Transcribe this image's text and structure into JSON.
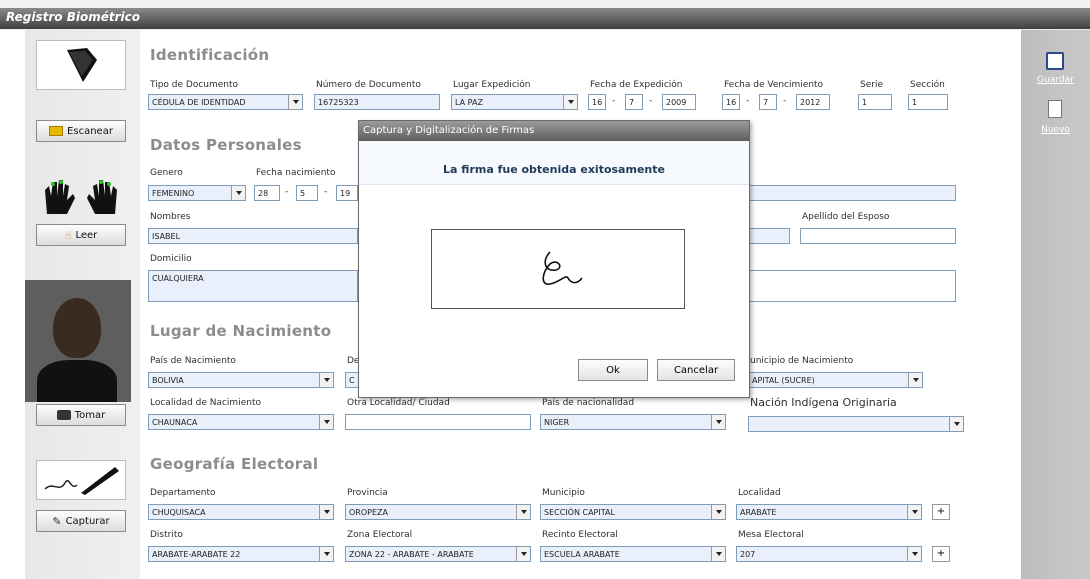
{
  "window": {
    "title": "Registro Biométrico"
  },
  "left": {
    "scan_button": "Escanear",
    "read_button": "Leer",
    "photo_button": "Tomar",
    "capture_button": "Capturar"
  },
  "right": {
    "save": "Guardar",
    "new": "Nuevo"
  },
  "identificacion": {
    "section": "Identificación",
    "tipo_doc_label": "Tipo de Documento",
    "tipo_doc": "CÉDULA DE IDENTIDAD",
    "num_doc_label": "Número de Documento",
    "num_doc": "16725323",
    "lugar_exp_label": "Lugar Expedición",
    "lugar_exp": "LA PAZ",
    "fecha_exp_label": "Fecha de Expedición",
    "fecha_exp": {
      "d": "16",
      "m": "7",
      "y": "2009"
    },
    "fecha_venc_label": "Fecha de Vencimiento",
    "fecha_venc": {
      "d": "16",
      "m": "7",
      "y": "2012"
    },
    "serie_label": "Serie",
    "serie": "1",
    "seccion_label": "Sección",
    "seccion": "1"
  },
  "datos": {
    "section": "Datos Personales",
    "genero_label": "Genero",
    "genero": "FEMENINO",
    "fnac_label": "Fecha nacimiento",
    "fnac": {
      "d": "28",
      "m": "5",
      "y": "19"
    },
    "nombres_label": "Nombres",
    "nombres": "ISABEL",
    "esposo_label": "Apellido del Esposo",
    "domicilio_label": "Domicilio",
    "domicilio": "CUALQUIERA"
  },
  "nacimiento": {
    "section": "Lugar de Nacimiento",
    "pais_label": "País de Nacimiento",
    "pais": "BOLIVIA",
    "depto_label_partial": "De",
    "depto_partial": "C",
    "municipio_label": "unicipio de Nacimiento",
    "municipio": "APITAL (SUCRE)",
    "localidad_label": "Localidad de Nacimiento",
    "localidad": "CHAUNACA",
    "otra_label": "Otra Localidad/ Ciudad",
    "nacionalidad_label": "País de nacionalidad",
    "nacionalidad": "NIGER",
    "indigena_label": "Nación Indígena Originaria"
  },
  "geografia": {
    "section": "Geografía Electoral",
    "depto_label": "Departamento",
    "depto": "CHUQUISACA",
    "provincia_label": "Provincia",
    "provincia": "OROPEZA",
    "municipio_label": "Municipio",
    "municipio": "SECCIÓN CAPITAL",
    "localidad_label": "Localidad",
    "localidad": "ARABATE",
    "distrito_label": "Distrito",
    "distrito": "ARABATE-ARABATE 22",
    "zona_label": "Zona Electoral",
    "zona": "ZONA 22 - ARABATE - ARABATE",
    "recinto_label": "Recinto Electoral",
    "recinto": "ESCUELA ARABATE",
    "mesa_label": "Mesa Electoral",
    "mesa": "207",
    "plus": "+"
  },
  "dialog": {
    "title": "Captura y Digitalización de Firmas",
    "message": "La firma fue obtenida exitosamente",
    "ok": "Ok",
    "cancel": "Cancelar"
  },
  "date_sep": "-"
}
